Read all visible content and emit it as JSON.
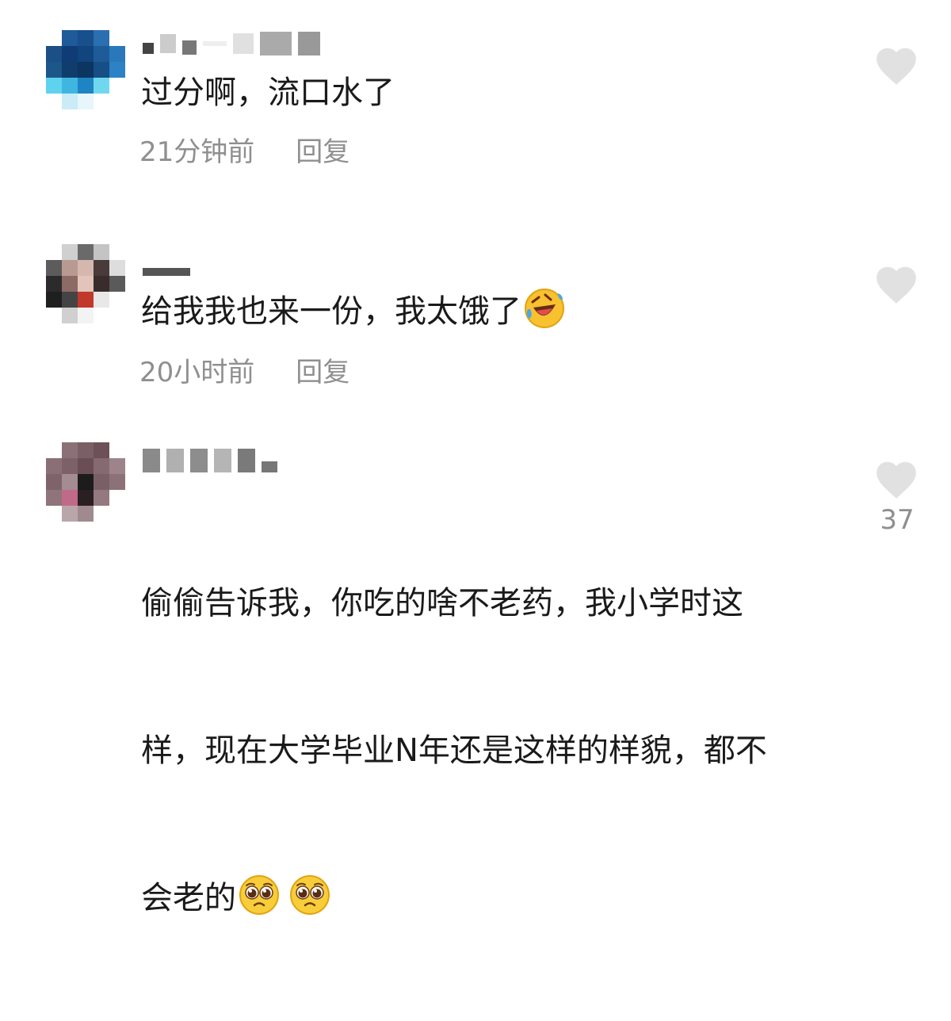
{
  "comments": [
    {
      "text": "过分啊，流口水了",
      "time": "21分钟前",
      "reply_label": "回复",
      "like_count": ""
    },
    {
      "text": "给我我也来一份，我太饿了",
      "emoji": "rofl-emoji",
      "time": "20小时前",
      "reply_label": "回复",
      "like_count": ""
    },
    {
      "text_line1": "偷偷告诉我，你吃的啥不老药，我小学时这",
      "text_line2": "样，现在大学毕业N年还是这样的样貌，都不",
      "text_line3": "会老的",
      "emoji": "pleading-face-emoji",
      "like_count": "37"
    }
  ],
  "colors": {
    "text": "#1a1a1a",
    "meta": "#8f8f8f",
    "heart": "#e1e1e1"
  }
}
